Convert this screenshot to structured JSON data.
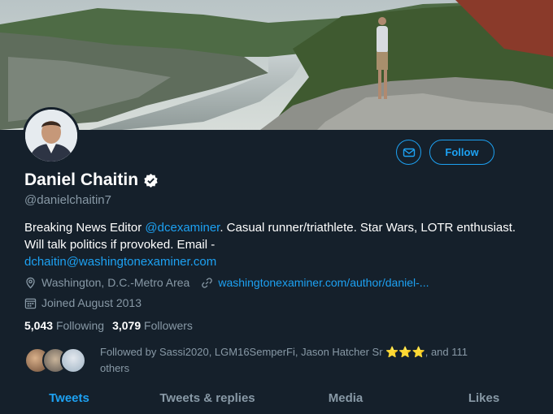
{
  "profile": {
    "name": "Daniel Chaitin",
    "handle": "@danielchaitin7",
    "verified_icon": "verified-badge-icon",
    "bio": {
      "part1": "Breaking News Editor ",
      "mention": "@dcexaminer",
      "part2": ". Casual runner/triathlete. Star Wars, LOTR enthusiast. Will talk politics if provoked. Email -",
      "email": "dchaitin@washingtonexaminer.com"
    },
    "location": "Washington, D.C.-Metro Area",
    "website": "washingtonexaminer.com/author/daniel-...",
    "joined": "Joined August 2013",
    "following_count": "5,043",
    "following_label": "Following",
    "followers_count": "3,079",
    "followers_label": "Followers",
    "followed_by": "Followed by Sassi2020, LGM16SemperFi, Jason Hatcher Sr ⭐⭐⭐, and 111 others"
  },
  "actions": {
    "follow_label": "Follow",
    "message_icon": "envelope-icon"
  },
  "tabs": [
    {
      "label": "Tweets"
    },
    {
      "label": "Tweets & replies"
    },
    {
      "label": "Media"
    },
    {
      "label": "Likes"
    }
  ],
  "colors": {
    "background": "#15202b",
    "accent": "#1da1f2",
    "secondary_text": "#8899a6"
  }
}
